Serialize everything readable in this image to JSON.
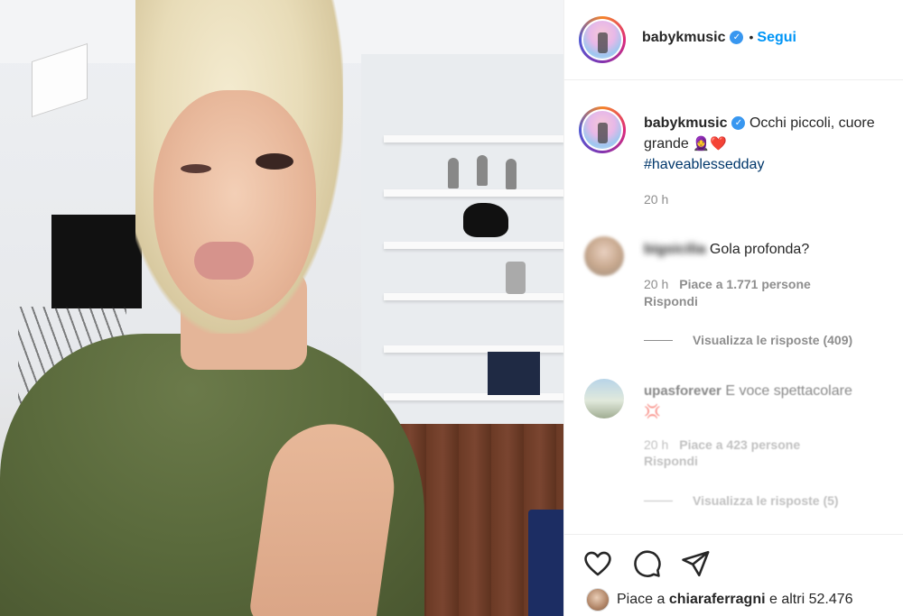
{
  "post": {
    "photo_alt": "",
    "header": {
      "username": "babykmusic",
      "separator": "•",
      "follow_label": "Segui"
    },
    "caption": {
      "username": "babykmusic",
      "text": "Occhi piccoli, cuore grande",
      "emoji": "🧕❤️",
      "hashtag": "#haveablessedday",
      "time": "20 h"
    },
    "comments": [
      {
        "username": "bigsicilia",
        "text": "Gola profonda?",
        "time": "20 h",
        "likes": "Piace a 1.771 persone",
        "reply_label": "Rispondi",
        "view_replies": "Visualizza le risposte (409)"
      },
      {
        "username": "upasforever",
        "text": "E voce spettacolare",
        "emoji": "💢",
        "time": "20 h",
        "likes": "Piace a 423 persone",
        "reply_label": "Rispondi",
        "view_replies": "Visualizza le risposte (5)"
      }
    ],
    "likes_summary": {
      "prefix": "Piace a",
      "user": "chiaraferragni",
      "suffix": "e altri 52.476"
    },
    "icons": {
      "verified": "verified-badge-icon",
      "like": "heart-icon",
      "comment": "comment-bubble-icon",
      "share": "paper-plane-icon"
    },
    "colors": {
      "link_blue": "#0095f6",
      "hashtag": "#00376b",
      "meta_gray": "#8e8e8e",
      "verified": "#3897f0"
    }
  }
}
